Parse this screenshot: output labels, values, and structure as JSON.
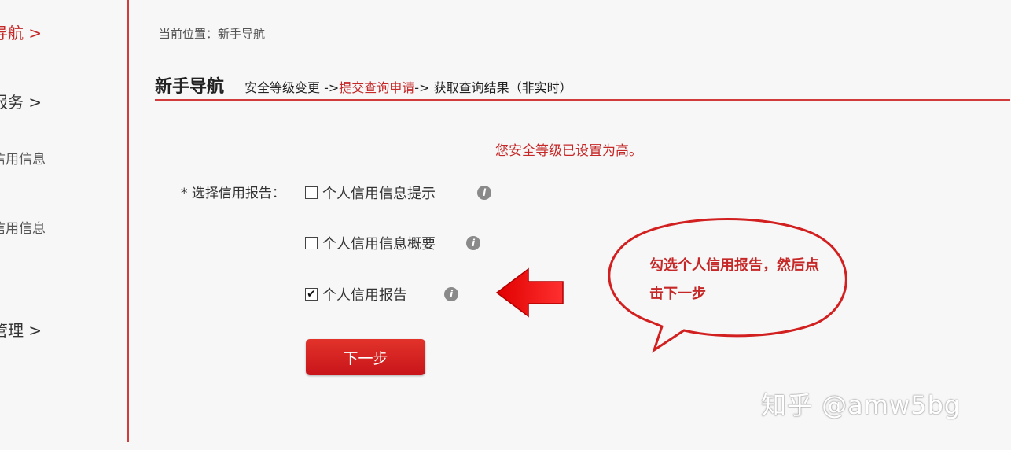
{
  "sidebar": {
    "items": [
      {
        "label": "导航 >"
      },
      {
        "label": "报务 >"
      },
      {
        "label": "信用信息"
      },
      {
        "label": "信用信息"
      },
      {
        "label": "管理 >"
      }
    ]
  },
  "breadcrumb": "当前位置：新手导航",
  "header": {
    "title": "新手导航",
    "step1": "安全等级变更 ->",
    "step2": "提交查询申请",
    "step3": "-> 获取查询结果（非实时）"
  },
  "notice": "您安全等级已设置为高。",
  "form": {
    "label": "* 选择信用报告：",
    "options": [
      {
        "label": "个人信用信息提示",
        "checked": false
      },
      {
        "label": "个人信用信息概要",
        "checked": false
      },
      {
        "label": "个人信用报告",
        "checked": true
      }
    ],
    "info_glyph": "i",
    "next_label": "下一步"
  },
  "annotation": {
    "text": "勾选个人信用报告，然后点击下一步"
  },
  "watermark": "知乎 @amw5bg",
  "colors": {
    "accent": "#c62828",
    "button": "#d8201f",
    "divider": "#d23b3b"
  }
}
